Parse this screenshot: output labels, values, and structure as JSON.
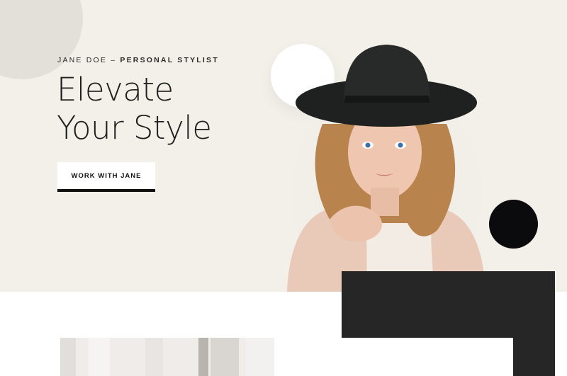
{
  "hero": {
    "eyebrow_name": "JANE DOE – ",
    "eyebrow_role": "PERSONAL STYLIST",
    "headline_line1": "Elevate",
    "headline_line2": "Your Style",
    "cta_label": "WORK WITH JANE"
  },
  "colors": {
    "hero_bg": "#f3f0ea",
    "accent_dark": "#262626",
    "dot": "#0b0b0d"
  }
}
